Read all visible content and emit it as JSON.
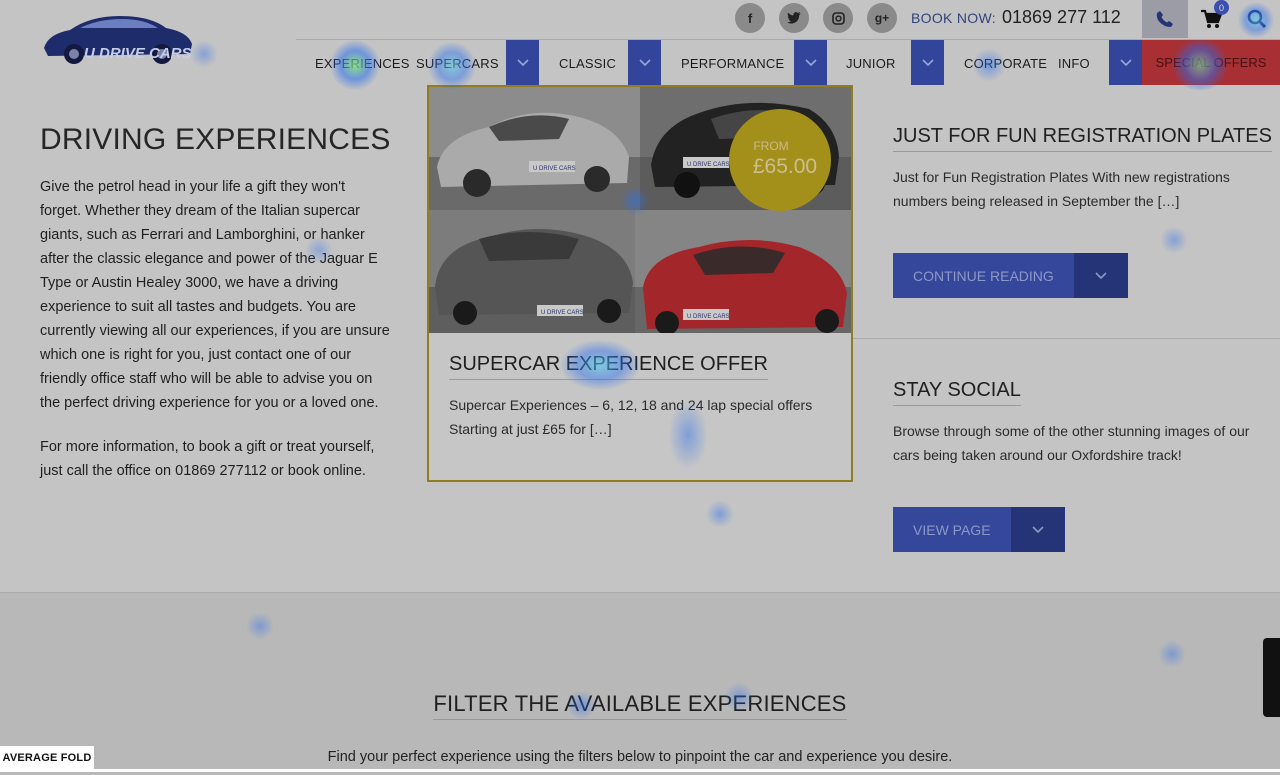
{
  "header": {
    "logo_alt": "U DRIVE CARS",
    "book_label": "BOOK NOW:",
    "book_phone": "01869 277 112",
    "cart_count": "0",
    "social_icons": [
      "facebook-icon",
      "twitter-icon",
      "instagram-icon",
      "google-plus-icon"
    ]
  },
  "nav": {
    "items": [
      {
        "label": "EXPERIENCES"
      },
      {
        "label": "SUPERCARS"
      },
      {
        "label": "CLASSIC"
      },
      {
        "label": "PERFORMANCE"
      },
      {
        "label": "JUNIOR"
      },
      {
        "label": "CORPORATE"
      },
      {
        "label": "INFO"
      }
    ],
    "special": "SPECIAL OFFERS"
  },
  "main": {
    "title": "DRIVING EXPERIENCES",
    "intro": "Give the petrol head in your life a gift they won't forget. Whether they dream of the Italian supercar giants, such as Ferrari and Lamborghini, or hanker after the classic elegance and power of the Jaguar E Type or Austin Healey 3000, we have a driving experience to suit all tastes and budgets. You are currently viewing all our experiences, if you are unsure which one is right for you, just contact one of our friendly office staff who will be able to advise you on the perfect driving experience for you or a loved one.",
    "intro2": "For more information, to book a gift or treat yourself, just call the office on 01869 277112 or book online."
  },
  "offer_card": {
    "price_from": "FROM",
    "price": "£65.00",
    "title": "SUPERCAR EXPERIENCE OFFER",
    "text": "Supercar Experiences – 6, 12, 18 and 24 lap special offers Starting at just £65 for […]",
    "plate_text": "U DRIVE CARS"
  },
  "sidebar": {
    "plates_title": "JUST FOR FUN REGISTRATION PLATES",
    "plates_text": "Just for Fun Registration Plates   With new registrations numbers being released in September the […]",
    "plates_button": "CONTINUE READING",
    "social_title": "STAY SOCIAL",
    "social_text": "Browse through some of the other stunning images of our cars being taken around our Oxfordshire track!",
    "social_button": "VIEW PAGE"
  },
  "filter": {
    "title": "FILTER THE AVAILABLE EXPERIENCES",
    "subtitle": "Find your perfect experience using the filters below to pinpoint the car and experience you desire."
  },
  "overlay": {
    "fold_label": "AVERAGE FOLD"
  }
}
